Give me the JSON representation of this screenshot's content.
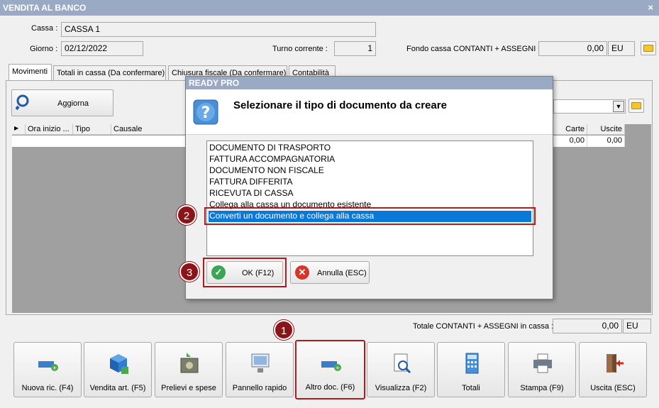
{
  "window": {
    "title": "VENDITA AL BANCO",
    "close": "×"
  },
  "header": {
    "cassa_label": "Cassa :",
    "cassa_value": "CASSA 1",
    "giorno_label": "Giorno :",
    "giorno_value": "02/12/2022",
    "turno_label": "Turno corrente :",
    "turno_value": "1",
    "fondo_label": "Fondo cassa CONTANTI + ASSEGNI :",
    "fondo_value": "0,00",
    "fondo_currency": "EU"
  },
  "tabs": [
    {
      "label": "Movimenti"
    },
    {
      "label": "Totali in cassa (Da confermare)"
    },
    {
      "label": "Chiusura fiscale (Da confermare)"
    },
    {
      "label": "Contabilità"
    }
  ],
  "panel": {
    "refresh_button": "Aggiorna",
    "grid_columns": [
      "Ora inizio ...",
      "Tipo",
      "Causale"
    ],
    "grid_right_columns": [
      "Carte",
      "Uscite"
    ],
    "grid_right_values": [
      "0,00",
      "0,00"
    ]
  },
  "totals": {
    "label": "Totale CONTANTI + ASSEGNI in cassa :",
    "value": "0,00",
    "currency": "EU"
  },
  "toolbar": [
    {
      "label": "Nuova ric. (F4)",
      "icon": "new-receipt-icon"
    },
    {
      "label": "Vendita art. (F5)",
      "icon": "sell-item-icon"
    },
    {
      "label": "Prelievi e spese",
      "icon": "safe-icon"
    },
    {
      "label": "Pannello rapido",
      "icon": "monitor-icon"
    },
    {
      "label": "Altro doc. (F6)",
      "icon": "other-document-icon"
    },
    {
      "label": "Visualizza (F2)",
      "icon": "view-document-icon"
    },
    {
      "label": "Totali",
      "icon": "calculator-icon"
    },
    {
      "label": "Stampa (F9)",
      "icon": "printer-icon"
    },
    {
      "label": "Uscita (ESC)",
      "icon": "exit-icon"
    }
  ],
  "dialog": {
    "title": "READY PRO",
    "question": "Selezionare il tipo di documento da creare",
    "options": [
      "DOCUMENTO DI TRASPORTO",
      "FATTURA ACCOMPAGNATORIA",
      "DOCUMENTO NON FISCALE",
      "FATTURA DIFFERITA",
      "RICEVUTA DI CASSA",
      "Collega alla cassa un documento esistente",
      "Converti un documento e collega alla cassa"
    ],
    "selected_index": 6,
    "ok_label": "OK (F12)",
    "cancel_label": "Annulla (ESC)"
  },
  "callouts": {
    "step1": "1",
    "step2": "2",
    "step3": "3"
  },
  "colors": {
    "highlight": "#b0191e",
    "badge": "#8b1418",
    "selection": "#0a78d7",
    "titlebar": "#9aa9c4"
  }
}
